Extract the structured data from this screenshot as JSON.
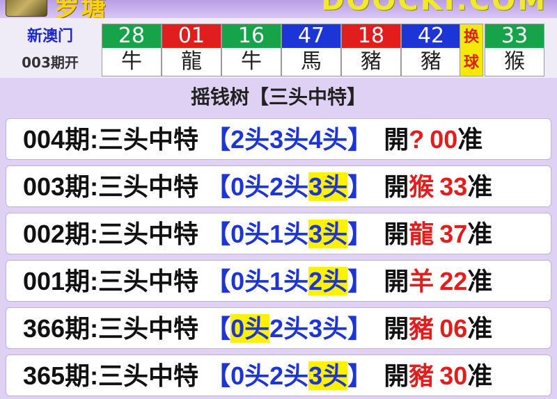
{
  "banner": {
    "left_text": "罗塘",
    "right_text": "DOOCKI.COM"
  },
  "draw": {
    "region": "新澳门",
    "issue": "003期开",
    "balls": [
      {
        "number": "28",
        "zodiac": "牛",
        "color": "green"
      },
      {
        "number": "01",
        "zodiac": "龍",
        "color": "red"
      },
      {
        "number": "16",
        "zodiac": "牛",
        "color": "green"
      },
      {
        "number": "47",
        "zodiac": "馬",
        "color": "blue"
      },
      {
        "number": "18",
        "zodiac": "豬",
        "color": "red"
      },
      {
        "number": "42",
        "zodiac": "豬",
        "color": "blue"
      }
    ],
    "swap_label": "换球",
    "special": {
      "number": "33",
      "zodiac": "猴",
      "color": "green"
    }
  },
  "table": {
    "title": "摇钱树【三头中特】",
    "rows": [
      {
        "period": "004期:三头中特",
        "heads": [
          "【",
          "2头",
          "3头",
          "4头",
          "】"
        ],
        "highlight": -1,
        "open_label": "開",
        "open_zodiac": "?",
        "open_number": "00",
        "accurate": "准"
      },
      {
        "period": "003期:三头中特",
        "heads": [
          "【",
          "0头",
          "2头",
          "3头",
          "】"
        ],
        "highlight": 3,
        "open_label": "開",
        "open_zodiac": "猴",
        "open_number": "33",
        "accurate": "准"
      },
      {
        "period": "002期:三头中特",
        "heads": [
          "【",
          "0头",
          "1头",
          "3头",
          "】"
        ],
        "highlight": 3,
        "open_label": "開",
        "open_zodiac": "龍",
        "open_number": "37",
        "accurate": "准"
      },
      {
        "period": "001期:三头中特",
        "heads": [
          "【",
          "0头",
          "1头",
          "2头",
          "】"
        ],
        "highlight": 3,
        "open_label": "開",
        "open_zodiac": "羊",
        "open_number": "22",
        "accurate": "准"
      },
      {
        "period": "366期:三头中特",
        "heads": [
          "【",
          "0头",
          "2头",
          "3头",
          "】"
        ],
        "highlight": 1,
        "open_label": "開",
        "open_zodiac": "豬",
        "open_number": "06",
        "accurate": "准"
      },
      {
        "period": "365期:三头中特",
        "heads": [
          "【",
          "0头",
          "2头",
          "3头",
          "】"
        ],
        "highlight": 3,
        "open_label": "開",
        "open_zodiac": "豬",
        "open_number": "30",
        "accurate": "准"
      }
    ]
  },
  "colors": {
    "green": "#16a34a",
    "red": "#e11d1d",
    "blue": "#1d35d6",
    "highlight": "#fff200",
    "panel": "#ded1f3"
  }
}
